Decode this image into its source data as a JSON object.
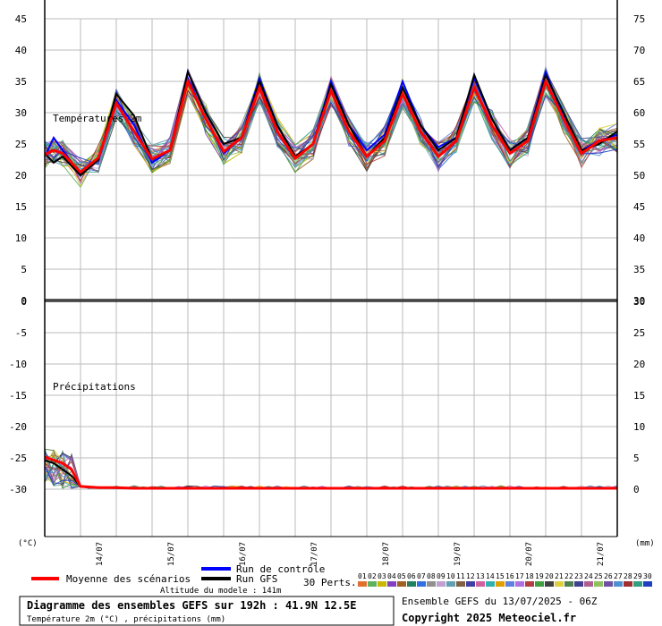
{
  "chart_data": {
    "type": "line",
    "temperature_panel": {
      "label": "Températures 2m",
      "left_ticks": [
        "45",
        "40",
        "35",
        "30",
        "25",
        "20",
        "15",
        "10",
        "5",
        "0"
      ],
      "right_ticks": [
        "75",
        "70",
        "65",
        "60",
        "55",
        "50",
        "45",
        "40",
        "35",
        "30"
      ],
      "ylim": [
        0,
        45
      ],
      "mean_series": [
        [
          0,
          23.3
        ],
        [
          3,
          24
        ],
        [
          6,
          23.5
        ],
        [
          12,
          20.5
        ],
        [
          18,
          22.8
        ],
        [
          24,
          31.5
        ],
        [
          30,
          27
        ],
        [
          36,
          22.6
        ],
        [
          42,
          24
        ],
        [
          48,
          35
        ],
        [
          54,
          29
        ],
        [
          60,
          23.8
        ],
        [
          66,
          26
        ],
        [
          72,
          34
        ],
        [
          78,
          27
        ],
        [
          84,
          22.7
        ],
        [
          90,
          25
        ],
        [
          96,
          33.5
        ],
        [
          102,
          27
        ],
        [
          108,
          23
        ],
        [
          114,
          25.5
        ],
        [
          120,
          33
        ],
        [
          126,
          27
        ],
        [
          132,
          23
        ],
        [
          138,
          25.5
        ],
        [
          144,
          34
        ],
        [
          150,
          28
        ],
        [
          156,
          23.5
        ],
        [
          162,
          25.5
        ],
        [
          168,
          35
        ],
        [
          174,
          29
        ],
        [
          180,
          23.5
        ],
        [
          186,
          25.5
        ],
        [
          192,
          26
        ]
      ],
      "gfs_series": [
        [
          0,
          23.5
        ],
        [
          3,
          22
        ],
        [
          6,
          23
        ],
        [
          12,
          20
        ],
        [
          18,
          22.5
        ],
        [
          24,
          33
        ],
        [
          30,
          29.5
        ],
        [
          36,
          22.5
        ],
        [
          42,
          24
        ],
        [
          48,
          36.5
        ],
        [
          54,
          30
        ],
        [
          60,
          25
        ],
        [
          66,
          26
        ],
        [
          72,
          35
        ],
        [
          78,
          28
        ],
        [
          84,
          23
        ],
        [
          90,
          25
        ],
        [
          96,
          34.5
        ],
        [
          102,
          28
        ],
        [
          108,
          23
        ],
        [
          114,
          26
        ],
        [
          120,
          34
        ],
        [
          126,
          28
        ],
        [
          132,
          24
        ],
        [
          138,
          26
        ],
        [
          144,
          36
        ],
        [
          150,
          29
        ],
        [
          156,
          24
        ],
        [
          162,
          26
        ],
        [
          168,
          36
        ],
        [
          174,
          30
        ],
        [
          180,
          24
        ],
        [
          186,
          25
        ],
        [
          192,
          27
        ]
      ],
      "control_series": [
        [
          0,
          23
        ],
        [
          3,
          26
        ],
        [
          6,
          24
        ],
        [
          12,
          20.2
        ],
        [
          18,
          22.5
        ],
        [
          24,
          32
        ],
        [
          30,
          28
        ],
        [
          36,
          22
        ],
        [
          42,
          24
        ],
        [
          48,
          35.5
        ],
        [
          54,
          29
        ],
        [
          60,
          23.5
        ],
        [
          66,
          26
        ],
        [
          72,
          35.5
        ],
        [
          78,
          28
        ],
        [
          84,
          23
        ],
        [
          90,
          25
        ],
        [
          96,
          35
        ],
        [
          102,
          28
        ],
        [
          108,
          24
        ],
        [
          114,
          26.5
        ],
        [
          120,
          35
        ],
        [
          126,
          28
        ],
        [
          132,
          24.5
        ],
        [
          138,
          26
        ],
        [
          144,
          35.5
        ],
        [
          150,
          29
        ],
        [
          156,
          24
        ],
        [
          162,
          26
        ],
        [
          168,
          36.5
        ],
        [
          174,
          29.5
        ],
        [
          180,
          24
        ],
        [
          186,
          25.5
        ],
        [
          192,
          26.5
        ]
      ]
    },
    "precipitation_panel": {
      "label": "Précipitations",
      "left_ticks": [
        "0",
        "-5",
        "-10",
        "-15",
        "-20",
        "-25",
        "-30"
      ],
      "right_ticks": [
        "30",
        "25",
        "20",
        "15",
        "10",
        "5",
        "0"
      ],
      "ylim_mm": [
        0,
        30
      ],
      "mean_series": [
        [
          0,
          5
        ],
        [
          3,
          4.5
        ],
        [
          6,
          4
        ],
        [
          9,
          3
        ],
        [
          12,
          0.3
        ],
        [
          18,
          0.1
        ],
        [
          24,
          0.1
        ],
        [
          30,
          0
        ],
        [
          192,
          0
        ]
      ],
      "gfs_series": [
        [
          0,
          4.5
        ],
        [
          3,
          4
        ],
        [
          6,
          3
        ],
        [
          9,
          2
        ],
        [
          12,
          0.3
        ],
        [
          18,
          0.1
        ],
        [
          30,
          0
        ],
        [
          192,
          0
        ]
      ]
    },
    "x_tick_labels": [
      "14/07",
      "15/07",
      "16/07",
      "17/07",
      "18/07",
      "19/07",
      "20/07",
      "21/07"
    ],
    "x_unit_left": "(°C)",
    "x_unit_right": "(mm)"
  },
  "legend": {
    "mean": "Moyenne des scénarios",
    "control": "Run de contrôle",
    "gfs": "Run GFS",
    "perts": "30 Perts.",
    "pert_numbers": [
      "01",
      "02",
      "03",
      "04",
      "05",
      "06",
      "07",
      "08",
      "09",
      "10",
      "11",
      "12",
      "13",
      "14",
      "15",
      "16",
      "17",
      "18",
      "19",
      "20",
      "21",
      "22",
      "23",
      "24",
      "25",
      "26",
      "27",
      "28",
      "29",
      "30"
    ],
    "altitude": "Altitude du modele : 141m"
  },
  "footer": {
    "title": "Diagramme des ensembles GEFS sur 192h : 41.9N 12.5E",
    "subtitle": "Température 2m (°C) , précipitations (mm)",
    "run": "Ensemble GEFS du 13/07/2025 - 06Z",
    "copyright": "Copyright 2025 Meteociel.fr"
  },
  "colors": {
    "mean": "#ff0000",
    "control": "#0000ff",
    "gfs": "#000000"
  }
}
